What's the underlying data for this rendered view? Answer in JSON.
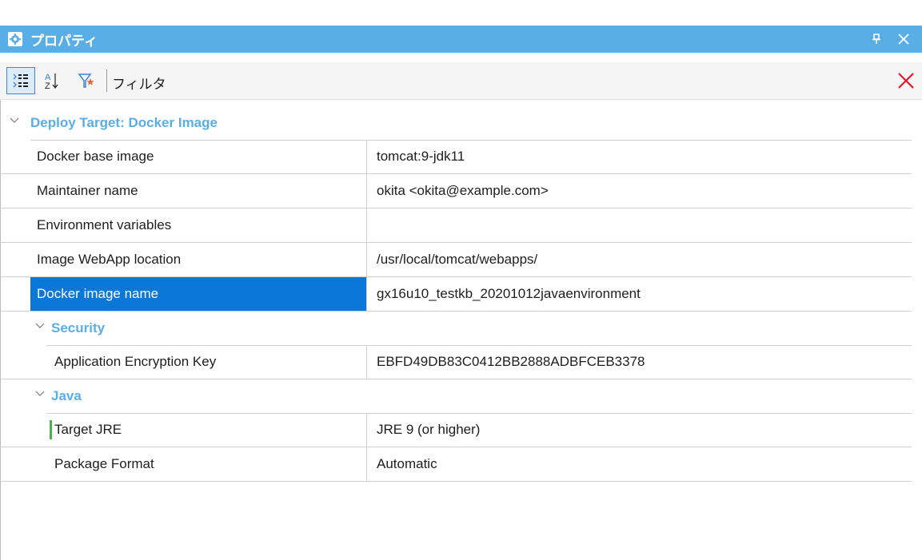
{
  "window": {
    "title": "プロパティ"
  },
  "toolbar": {
    "filter_label": "フィルタ",
    "filter_value": ""
  },
  "groups": [
    {
      "label": "Deploy Target: Docker Image",
      "rows": [
        {
          "name": "Docker base image",
          "value": "tomcat:9-jdk11"
        },
        {
          "name": "Maintainer name",
          "value": "okita <okita@example.com>"
        },
        {
          "name": "Environment variables",
          "value": ""
        },
        {
          "name": "Image WebApp location",
          "value": "/usr/local/tomcat/webapps/"
        },
        {
          "name": "Docker image name",
          "value": "gx16u10_testkb_20201012javaenvironment",
          "selected": true
        }
      ]
    },
    {
      "label": "Security",
      "rows": [
        {
          "name": "Application Encryption Key",
          "value": "EBFD49DB83C0412BB2888ADBFCEB3378"
        }
      ]
    },
    {
      "label": "Java",
      "rows": [
        {
          "name": "Target JRE",
          "value": "JRE 9 (or higher)",
          "modified": true
        },
        {
          "name": "Package Format",
          "value": "Automatic"
        }
      ]
    }
  ],
  "colors": {
    "title_bar": "#5aaee6",
    "category_text": "#5aaee6",
    "selection": "#0b78d7",
    "clear_icon": "#e81123",
    "modified_marker": "#4caf50"
  }
}
